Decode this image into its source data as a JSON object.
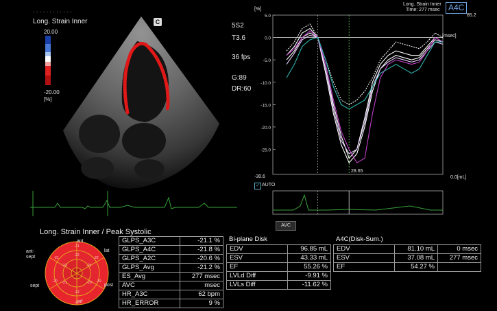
{
  "colors": {
    "curve_white": "#ffffff",
    "curve_cyan": "#2fb6b0",
    "curve_magenta": "#c040c8",
    "roi": "#e01818",
    "ecg": "#3aa23a",
    "bullseye_red": "#e8242c",
    "bullseye_deep": "#c01820"
  },
  "header": {
    "view_badge": "A4C",
    "title_right": "Long. Strain Inner",
    "time_readout": "Time: 277 msec"
  },
  "image_panel": {
    "mode_label": "Long. Strain Inner",
    "orientation_mark": "C",
    "scale_max": "20.00",
    "scale_min": "-20.00",
    "scale_unit": "[%]"
  },
  "acq": {
    "probe": "5S2",
    "tissue": "T3.6",
    "fps": "36 fps",
    "gain": "G:89",
    "dr": "DR:60"
  },
  "graph": {
    "y_unit": "[%]",
    "y_max_label": "85.2",
    "x_unit_right": "[msec]",
    "bottom_unit": "0.0[mL]",
    "min_label": "-30.6",
    "peak_label": "28.65",
    "y_ticks": [
      "5.0",
      "0.0",
      "-5.0",
      "-10.0",
      "-15.0",
      "-20.0",
      "-25.0"
    ],
    "auto_label": "AUTO",
    "avc_label": "AVC"
  },
  "results_title": "Long. Strain Inner / Peak Systolic",
  "bullseye": {
    "labels": {
      "ant": "ant",
      "lat": "lat",
      "post": "post",
      "inf": "inf",
      "sept": "sept",
      "antsept": "ant-\nsept"
    }
  },
  "gls_table": [
    [
      "GLPS_A3C",
      "-21.1 %"
    ],
    [
      "GLPS_A4C",
      "-21.8 %"
    ],
    [
      "GLPS_A2C",
      "-20.6 %"
    ],
    [
      "GLPS_Avg",
      "-21.2 %"
    ],
    [
      "ES_Avg",
      "277 msec"
    ],
    [
      "AVC",
      "msec"
    ],
    [
      "HR_A3C",
      "62 bpm"
    ],
    [
      "HR_ERROR",
      "9 %"
    ]
  ],
  "biplane": {
    "title": "Bi-plane Disk",
    "rows": [
      [
        "EDV",
        "96.85 mL"
      ],
      [
        "ESV",
        "43.33 mL"
      ],
      [
        "EF",
        "55.26 %"
      ],
      [
        "LVLd Diff",
        "-9.91 %"
      ],
      [
        "LVLs Diff",
        "-11.62 %"
      ]
    ]
  },
  "a4c": {
    "title": "A4C(Disk-Sum.)",
    "rows": [
      [
        "EDV",
        "81.10 mL",
        "0 msec"
      ],
      [
        "ESV",
        "37.08 mL",
        "277 msec"
      ],
      [
        "EF",
        "54.27 %",
        ""
      ]
    ]
  },
  "chart_data": {
    "type": "line",
    "title": "Long. Strain Inner",
    "ylabel": "[%]",
    "ylim": [
      -30.6,
      5.0
    ],
    "x_unit": "msec",
    "x": [
      0,
      1,
      2,
      3,
      4,
      5,
      6,
      7,
      8,
      9,
      10,
      11,
      12,
      13,
      14,
      15,
      16,
      17,
      18,
      19,
      20
    ],
    "series": [
      {
        "color": "#ffffff",
        "dashed": true,
        "values": [
          -3,
          -1,
          2,
          3,
          0,
          -5,
          -10,
          -14,
          -15,
          -14,
          -12,
          -9,
          -5,
          -3,
          -1,
          -1.5,
          -2,
          -2.5,
          -1,
          1,
          0
        ]
      },
      {
        "color": "#ffffff",
        "values": [
          -4,
          -2,
          1,
          2,
          0,
          -7,
          -15,
          -22,
          -27,
          -25,
          -18,
          -10,
          -6,
          -4,
          -3,
          -3.5,
          -4,
          -4,
          -2,
          0,
          -1
        ]
      },
      {
        "color": "#ffffff",
        "values": [
          -5,
          -3,
          0,
          1,
          0,
          -8,
          -17,
          -24,
          -28,
          -26,
          -20,
          -12,
          -7,
          -5,
          -4,
          -4.5,
          -5,
          -4.5,
          -2.5,
          -0.5,
          -1
        ]
      },
      {
        "color": "#e8d0ff",
        "values": [
          -6,
          -3.5,
          -0.5,
          0.5,
          0,
          -7,
          -16,
          -23,
          -26,
          -25,
          -19,
          -11,
          -7,
          -5.5,
          -4.5,
          -5,
          -5.5,
          -5,
          -3,
          -1,
          -1.5
        ]
      },
      {
        "color": "#c040c8",
        "values": [
          -4,
          -2.5,
          0,
          1.5,
          0,
          -6,
          -14,
          -21,
          -25,
          -28,
          -27,
          -17,
          -9,
          -6,
          -5,
          -5.5,
          -6,
          -5.5,
          -3,
          0,
          -1
        ]
      },
      {
        "color": "#2fb6b0",
        "values": [
          -9,
          -6,
          -2,
          -0.5,
          0,
          -5,
          -11,
          -15,
          -16,
          -15,
          -14,
          -11,
          -8,
          -7,
          -6,
          -7,
          -8,
          -7,
          -4,
          -1,
          -1
        ]
      }
    ]
  }
}
